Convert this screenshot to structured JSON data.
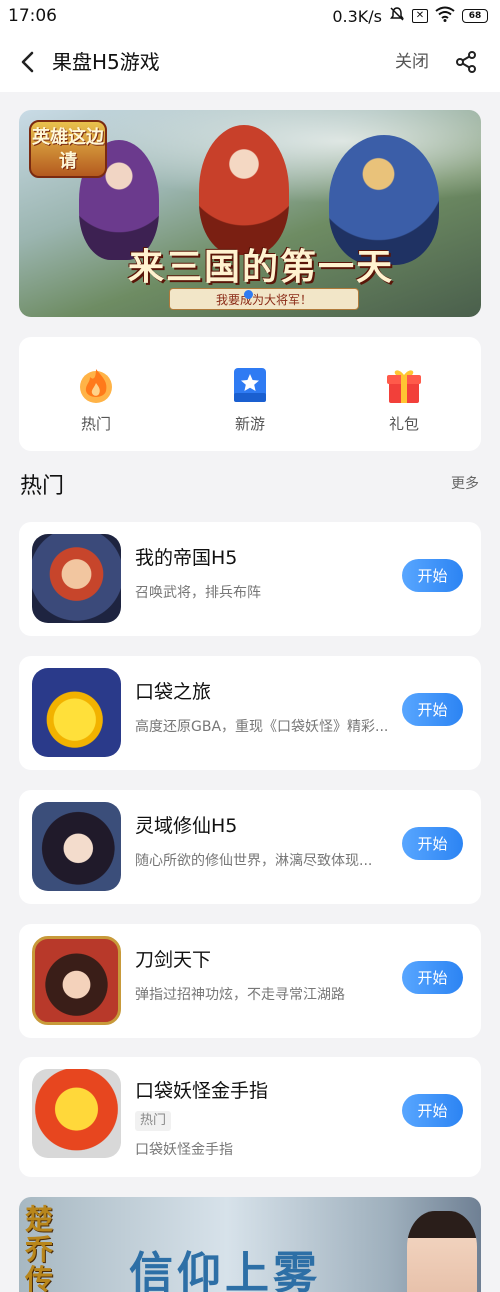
{
  "status_bar": {
    "time": "17:06",
    "net_speed": "0.3K/s",
    "battery": "68"
  },
  "header": {
    "title": "果盘H5游戏",
    "close_label": "关闭"
  },
  "banner": {
    "logo_text": "英雄这边请",
    "title": "来三国的第一天",
    "subtitle": "我要成为大将军！"
  },
  "quick_nav": [
    {
      "label": "热门",
      "icon": "fire-icon"
    },
    {
      "label": "新游",
      "icon": "new-game-star-icon"
    },
    {
      "label": "礼包",
      "icon": "gift-icon"
    }
  ],
  "section": {
    "title": "热门",
    "more_label": "更多"
  },
  "games": [
    {
      "name": "我的帝国H5",
      "desc": "召唤武将，排兵布阵",
      "button": "开始"
    },
    {
      "name": "口袋之旅",
      "desc": "高度还原GBA，重现《口袋妖怪》精彩...",
      "button": "开始"
    },
    {
      "name": "灵域修仙H5",
      "desc": "随心所欲的修仙世界，淋漓尽致体现...",
      "button": "开始"
    },
    {
      "name": "刀剑天下",
      "desc": "弹指过招神功炫，不走寻常江湖路",
      "button": "开始"
    },
    {
      "name": "口袋妖怪金手指",
      "tag": "热门",
      "desc": "口袋妖怪金手指",
      "button": "开始"
    }
  ],
  "bottom_banner": {
    "logo": "楚乔传",
    "title": "信仰上雾"
  },
  "colors": {
    "accent": "#2c84f3",
    "background": "#f3f3f5"
  }
}
